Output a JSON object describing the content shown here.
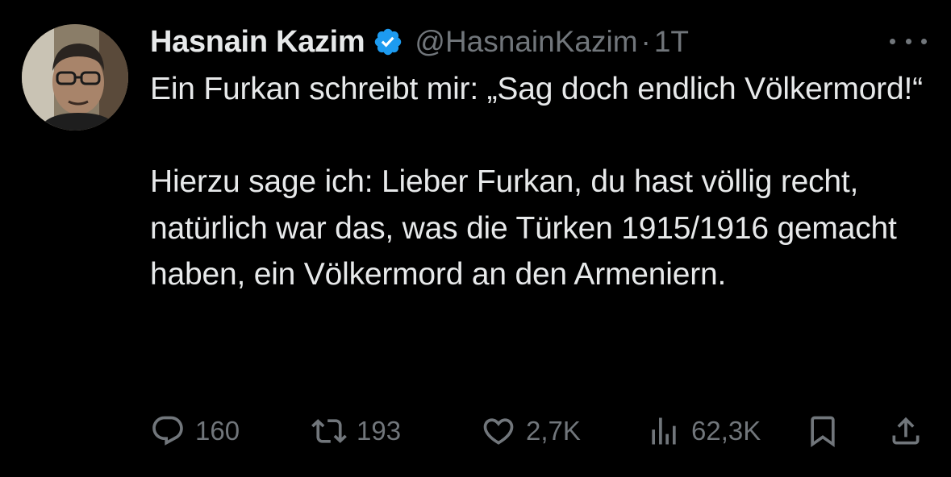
{
  "author": {
    "display_name": "Hasnain Kazim",
    "handle": "@HasnainKazim",
    "separator": "·",
    "time": "1T",
    "verified": true,
    "verified_color": "#1d9bf0",
    "avatar_icon": "profile-photo"
  },
  "tweet": {
    "paragraphs": [
      "Ein Furkan schreibt mir: „Sag doch endlich Völkermord!“",
      "Hierzu sage ich: Lieber Furkan, du hast völlig recht, natürlich war das, was die Türken 1915/1916 gemacht haben, ein Völkermord an den Armeniern."
    ]
  },
  "actions": {
    "replies": "160",
    "retweets": "193",
    "likes": "2,7K",
    "views": "62,3K",
    "icons": [
      "reply-icon",
      "retweet-icon",
      "like-icon",
      "views-icon",
      "bookmark-icon",
      "share-icon"
    ]
  },
  "colors": {
    "background": "#000000",
    "text": "#e7e9ea",
    "muted": "#71767b"
  }
}
